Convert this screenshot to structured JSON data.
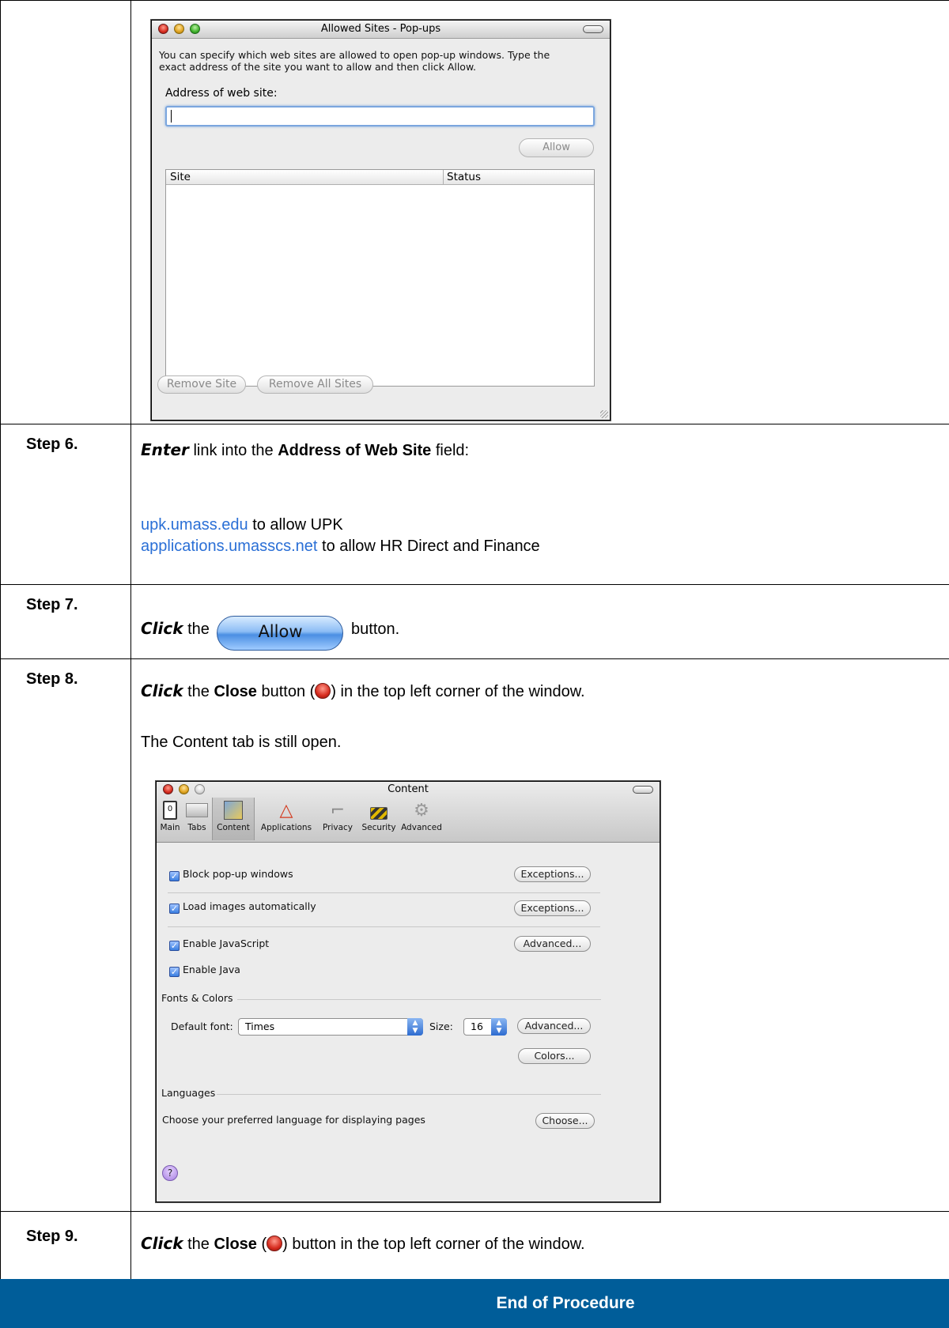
{
  "popup_window": {
    "title": "Allowed Sites - Pop-ups",
    "description_line1": "You can specify which web sites are allowed to open pop-up windows. Type the",
    "description_line2": "exact address of the site you want to allow and then click Allow.",
    "address_label": "Address of web site:",
    "address_value": "",
    "allow_button": "Allow",
    "columns": [
      "Site",
      "Status"
    ],
    "remove_site_button": "Remove Site",
    "remove_all_button": "Remove All Sites"
  },
  "steps": {
    "step6": {
      "label": "Step 6.",
      "verb": "Enter",
      "text_a": " link into the ",
      "field_name": "Address of Web Site",
      "text_b": " field:",
      "link1": "upk.umass.edu",
      "link1_suffix": " to  allow UPK",
      "link2": "applications.umasscs.net",
      "link2_suffix": " to allow HR Direct and Finance"
    },
    "step7": {
      "label": "Step 7.",
      "verb": "Click",
      "text_a": " the ",
      "button_image_label": "Allow",
      "text_b": " button."
    },
    "step8": {
      "label": "Step 8.",
      "verb": "Click",
      "text_a": " the ",
      "bold": "Close",
      "text_b": " button (",
      "text_c": ") in the top left corner of the window.",
      "note": "The Content tab is still open."
    },
    "step9": {
      "label": "Step 9.",
      "verb": "Click",
      "text_a": " the ",
      "bold": "Close",
      "text_b": " (",
      "text_c": ") button in the top left corner of the window."
    }
  },
  "content_window": {
    "title": "Content",
    "toolbar": [
      {
        "label": "Main",
        "icon": "switch-icon"
      },
      {
        "label": "Tabs",
        "icon": "tabs-icon"
      },
      {
        "label": "Content",
        "icon": "content-icon"
      },
      {
        "label": "Applications",
        "icon": "applications-icon"
      },
      {
        "label": "Privacy",
        "icon": "privacy-icon"
      },
      {
        "label": "Security",
        "icon": "lock-icon"
      },
      {
        "label": "Advanced",
        "icon": "gear-icon"
      }
    ],
    "block_popups": "Block pop-up windows",
    "load_images": "Load images automatically",
    "enable_js": "Enable JavaScript",
    "enable_java": "Enable Java",
    "exceptions_button": "Exceptions...",
    "advanced_button": "Advanced...",
    "fonts_colors_heading": "Fonts & Colors",
    "default_font_label": "Default font:",
    "default_font_value": "Times",
    "size_label": "Size:",
    "size_value": "16",
    "colors_button": "Colors...",
    "languages_heading": "Languages",
    "languages_text": "Choose your preferred language for displaying pages",
    "choose_button": "Choose...",
    "help_glyph": "?"
  },
  "footer": {
    "text": "End of Procedure"
  }
}
